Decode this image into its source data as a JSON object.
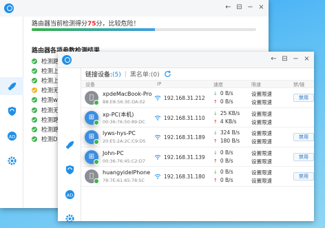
{
  "back_window": {
    "score_prefix": "路由器当前检测得分",
    "score_value": "75",
    "score_unit": "分，",
    "score_suffix": "比较危险！",
    "progress_fraction": 0.55,
    "section_title": "路由器各项参数检测结果",
    "check_items": [
      {
        "label": "检测路由器",
        "status": "ok"
      },
      {
        "label": "检测上网帐号",
        "status": "ok"
      },
      {
        "label": "检测上网",
        "status": "ok"
      },
      {
        "label": "检测无线W",
        "status": "warn"
      },
      {
        "label": "检测wps",
        "status": "ok"
      },
      {
        "label": "检测无线W",
        "status": "ok"
      },
      {
        "label": "检测路由器",
        "status": "ok"
      },
      {
        "label": "检测路由器",
        "status": "ok"
      },
      {
        "label": "检测DNS",
        "status": "ok"
      }
    ]
  },
  "front_window": {
    "tab_connected": "链接设备:",
    "tab_connected_count": "(5)",
    "tab_blacklist": "黑名单:(0)",
    "table_headers": {
      "device": "设备",
      "ip": "IP",
      "speed": "速度",
      "limit": "限速",
      "ban": "禁/链"
    },
    "devices": [
      {
        "name": "xpdeMacBook-Pro",
        "mac": "B8:E8:56:3E:DA:02",
        "type": "apple",
        "ip": "192.168.31.212",
        "up": "0 B/s",
        "down": "0 B/s",
        "limit_up": "设置限速",
        "limit_down": "设置限速",
        "action": "禁用"
      },
      {
        "name": "xp-PC(本机)",
        "mac": "00:36:76:50:89:DC",
        "type": "windows",
        "ip": "192.168.31.110",
        "up": "25 KB/s",
        "down": "4 KB/s",
        "limit_up": "设置限速",
        "limit_down": "设置限速",
        "action": ""
      },
      {
        "name": "lyws-hys-PC",
        "mac": "20:E5:2A:2C:C9:D5",
        "type": "windows",
        "ip": "192.168.31.189",
        "up": "324 B/s",
        "down": "180 B/s",
        "limit_up": "设置限速",
        "limit_down": "设置限速",
        "action": "禁用"
      },
      {
        "name": "John-PC",
        "mac": "00:36:76:45:C2:D7",
        "type": "windows",
        "ip": "192.168.31.139",
        "up": "0 B/s",
        "down": "0 B/s",
        "limit_up": "设置限速",
        "limit_down": "设置限速",
        "action": "禁用"
      },
      {
        "name": "huangyidelPhone",
        "mac": "78:7E:61:65:78:5C",
        "type": "apple",
        "ip": "192.168.31.180",
        "up": "0 B/s",
        "down": "0 B/s",
        "limit_up": "设置限速",
        "limit_down": "设置限速",
        "action": "禁用"
      }
    ]
  },
  "window_controls": {
    "back": "←",
    "feedback": "⊟",
    "minimize": "−",
    "close": "×"
  },
  "icons": {
    "apple": "apple-icon",
    "windows": "windows-icon",
    "wifi": "wifi-icon"
  },
  "colors": {
    "accent": "#1f8fe8",
    "danger": "#e8262c",
    "ok": "#3fb34f",
    "warn": "#f2b51c"
  }
}
